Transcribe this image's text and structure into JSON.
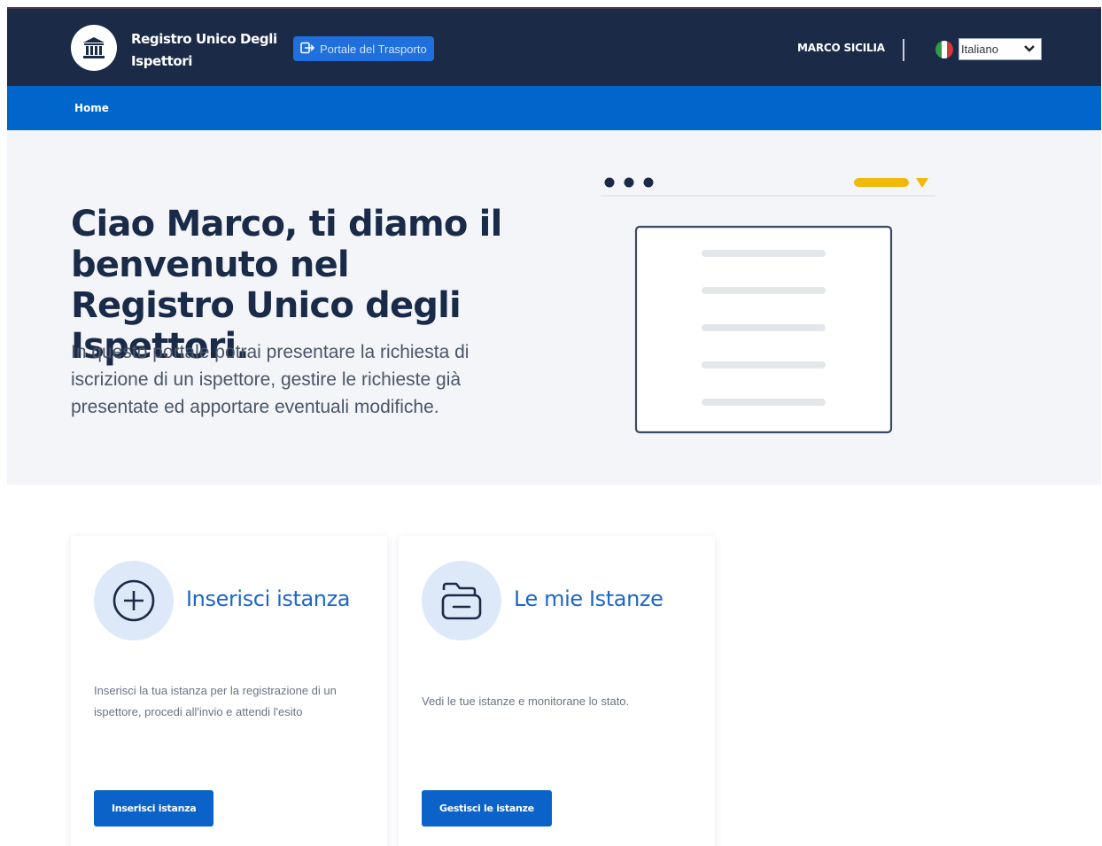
{
  "header": {
    "brand_line1": "Registro Unico Degli",
    "brand_line2": "Ispettori",
    "portal_button_label": "Portale del Trasporto",
    "user_name": "MARCO SICILIA",
    "language_selected": "Italiano",
    "logo_icon": "institution-icon",
    "portal_icon": "external-link-icon",
    "flag_icon": "italian-flag-icon"
  },
  "nav": {
    "home_label": "Home"
  },
  "hero": {
    "title": "Ciao Marco, ti diamo il benvenuto nel Registro Unico degli Ispettori.",
    "description": "In questo portale potrai presentare la richiesta di iscrizione di un ispettore, gestire le richieste già presentate ed apportare eventuali modifiche."
  },
  "cards": [
    {
      "icon": "plus-circle-icon",
      "title": "Inserisci istanza",
      "description": "Inserisci la tua istanza per la registrazione di un ispettore, procedi all'invio e attendi l'esito",
      "button_label": "Inserisci istanza"
    },
    {
      "icon": "folder-icon",
      "title": "Le mie Istanze",
      "description": "Vedi le tue istanze e monitorane lo stato.",
      "button_label": "Gestisci le istanze"
    }
  ],
  "colors": {
    "header_bg": "#1b2a47",
    "nav_bg": "#0066cc",
    "hero_bg": "#f3f5f8",
    "accent": "#1d66c9",
    "button_bg": "#0b63c9",
    "illustration_yellow": "#f0b90b"
  }
}
